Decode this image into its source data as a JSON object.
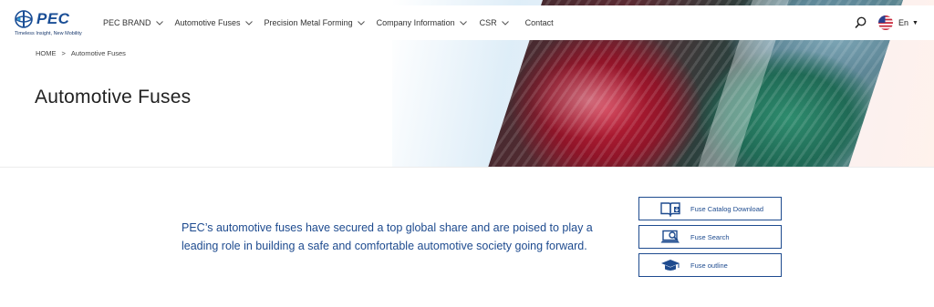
{
  "header": {
    "logo_text": "PEC",
    "logo_tagline": "Timeless Insight, New Mobility",
    "nav": [
      {
        "label": "PEC BRAND",
        "icon": "chevron-down-icon"
      },
      {
        "label": "Automotive Fuses",
        "icon": "chevron-down-icon"
      },
      {
        "label": "Precision Metal Forming",
        "icon": "chevron-down-icon"
      },
      {
        "label": "Company Information",
        "icon": "chevron-down-icon"
      },
      {
        "label": "CSR",
        "icon": "chevron-down-icon"
      },
      {
        "label": "Contact"
      }
    ],
    "search_icon": "search-icon",
    "language": {
      "label": "En",
      "caret": "▼",
      "flag": "us-flag-icon"
    }
  },
  "breadcrumb": {
    "home": "HOME",
    "separator": ">",
    "current": "Automotive Fuses"
  },
  "page_title": "Automotive Fuses",
  "intro_text": "PEC’s automotive fuses have secured a top global share and are poised to play a leading role in building a safe and comfortable automotive society going forward.",
  "links": [
    {
      "label": "Fuse Catalog Download",
      "icon": "catalog-download-icon"
    },
    {
      "label": "Fuse Search",
      "icon": "laptop-search-icon"
    },
    {
      "label": "Fuse outline",
      "icon": "graduation-cap-icon"
    }
  ],
  "colors": {
    "brand_blue": "#1e4b8f",
    "logo_blue": "#1a4e96",
    "text_dark": "#222222"
  }
}
